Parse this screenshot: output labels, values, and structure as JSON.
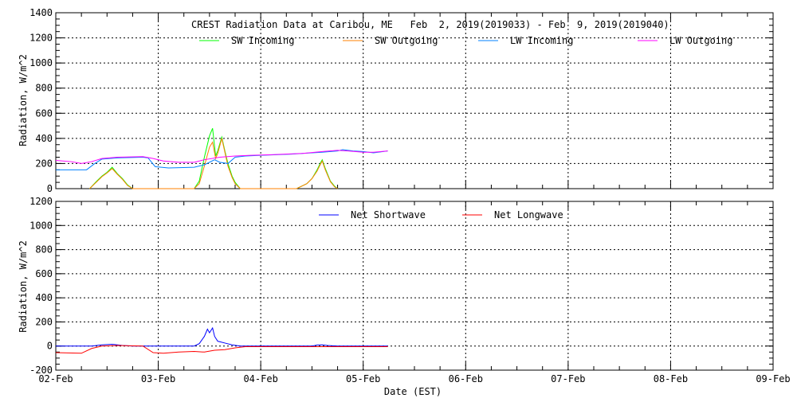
{
  "chart_data": [
    {
      "type": "line",
      "title": "CREST Radiation Data at Caribou, ME   Feb  2, 2019(2019033) - Feb  9, 2019(2019040)",
      "ylabel": "Radiation, W/m^2",
      "ylim": [
        0,
        1400
      ],
      "yticks": [
        0,
        200,
        400,
        600,
        800,
        1000,
        1200,
        1400
      ],
      "xlim": [
        0,
        7
      ],
      "grid": true,
      "legend": "top",
      "series": [
        {
          "name": "SW Incoming",
          "color": "#00ff00",
          "x": [
            0.33,
            0.4,
            0.45,
            0.5,
            0.55,
            0.6,
            0.65,
            0.7,
            0.75,
            1.35,
            1.4,
            1.45,
            1.5,
            1.53,
            1.56,
            1.58,
            1.62,
            1.65,
            1.68,
            1.72,
            1.75,
            1.8,
            2.35,
            2.45,
            2.5,
            2.55,
            2.58,
            2.6,
            2.63,
            2.68,
            2.72,
            2.75
          ],
          "y": [
            0,
            60,
            100,
            130,
            170,
            120,
            80,
            30,
            0,
            0,
            60,
            250,
            420,
            480,
            260,
            300,
            410,
            300,
            200,
            100,
            50,
            0,
            0,
            40,
            80,
            150,
            200,
            230,
            160,
            60,
            20,
            0
          ]
        },
        {
          "name": "SW Outgoing",
          "color": "#ff8000",
          "x": [
            0.33,
            0.4,
            0.45,
            0.5,
            0.55,
            0.6,
            0.65,
            0.7,
            0.75,
            1.35,
            1.4,
            1.45,
            1.5,
            1.53,
            1.56,
            1.58,
            1.62,
            1.65,
            1.68,
            1.72,
            1.75,
            1.8,
            2.35,
            2.45,
            2.5,
            2.55,
            2.58,
            2.6,
            2.63,
            2.68,
            2.72,
            2.75
          ],
          "y": [
            0,
            55,
            95,
            125,
            160,
            115,
            75,
            25,
            0,
            0,
            40,
            180,
            330,
            370,
            240,
            280,
            400,
            290,
            180,
            90,
            40,
            0,
            0,
            40,
            80,
            140,
            190,
            220,
            150,
            55,
            15,
            0
          ]
        },
        {
          "name": "LW Incoming",
          "color": "#0080ff",
          "x": [
            0,
            0.3,
            0.38,
            0.45,
            0.6,
            0.85,
            0.9,
            0.97,
            1.1,
            1.35,
            1.45,
            1.55,
            1.6,
            1.68,
            1.75,
            1.85,
            2.0,
            2.3,
            2.6,
            2.75,
            2.8,
            2.9,
            3.0,
            3.1,
            3.24
          ],
          "y": [
            150,
            150,
            200,
            235,
            245,
            250,
            245,
            175,
            165,
            170,
            190,
            230,
            210,
            200,
            250,
            260,
            265,
            275,
            290,
            300,
            310,
            300,
            295,
            285,
            300
          ]
        },
        {
          "name": "LW Outgoing",
          "color": "#ff00ff",
          "x": [
            0,
            0.15,
            0.25,
            0.35,
            0.45,
            0.6,
            0.85,
            0.95,
            1.05,
            1.2,
            1.35,
            1.45,
            1.6,
            1.75,
            1.9,
            2.1,
            2.4,
            2.6,
            2.75,
            2.85,
            3.0,
            3.1,
            3.24
          ],
          "y": [
            225,
            215,
            200,
            215,
            240,
            250,
            255,
            240,
            220,
            210,
            210,
            230,
            250,
            260,
            265,
            270,
            280,
            295,
            305,
            300,
            290,
            290,
            300
          ]
        }
      ]
    },
    {
      "type": "line",
      "xlabel": "Date (EST)",
      "ylabel": "Radiation, W/m^2",
      "ylim": [
        -200,
        1200
      ],
      "yticks": [
        -200,
        0,
        200,
        400,
        600,
        800,
        1000,
        1200
      ],
      "xlim": [
        0,
        7
      ],
      "xticks": [
        "02-Feb",
        "03-Feb",
        "04-Feb",
        "05-Feb",
        "06-Feb",
        "07-Feb",
        "08-Feb",
        "09-Feb"
      ],
      "grid": true,
      "legend": "top",
      "series": [
        {
          "name": "Net Shortwave",
          "color": "#0000ff",
          "x": [
            0,
            0.35,
            0.45,
            0.55,
            0.65,
            0.75,
            1.35,
            1.4,
            1.45,
            1.48,
            1.5,
            1.53,
            1.55,
            1.58,
            1.65,
            1.72,
            1.8,
            2.5,
            2.55,
            2.6,
            2.65,
            2.75,
            3.24
          ],
          "y": [
            0,
            0,
            10,
            15,
            5,
            0,
            0,
            20,
            80,
            140,
            110,
            150,
            80,
            40,
            25,
            10,
            0,
            0,
            8,
            10,
            5,
            0,
            0
          ]
        },
        {
          "name": "Net Longwave",
          "color": "#ff0000",
          "x": [
            0,
            0.25,
            0.35,
            0.45,
            0.6,
            0.85,
            0.95,
            1.05,
            1.2,
            1.35,
            1.45,
            1.55,
            1.65,
            1.75,
            1.85,
            2.0,
            2.5,
            2.75,
            3.0,
            3.24
          ],
          "y": [
            -55,
            -60,
            -20,
            0,
            5,
            0,
            -55,
            -60,
            -50,
            -45,
            -50,
            -35,
            -30,
            -15,
            -5,
            -5,
            -5,
            -5,
            -5,
            -5
          ]
        }
      ]
    }
  ]
}
